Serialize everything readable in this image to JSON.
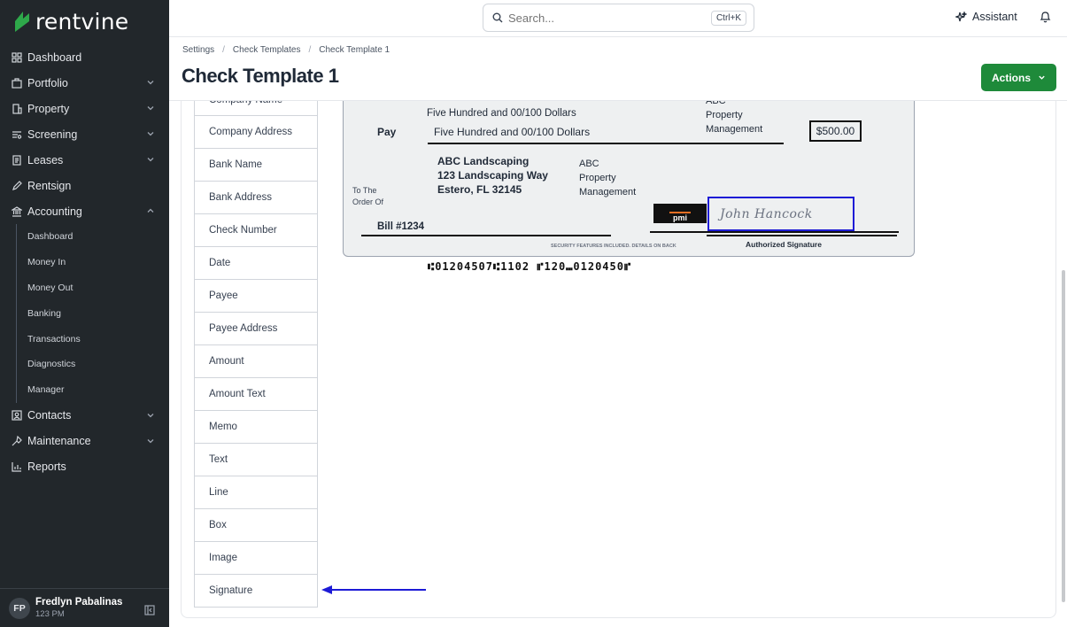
{
  "app": {
    "brand": "rentvine",
    "accent": "#1e8a3a"
  },
  "sidebar": {
    "items": [
      {
        "label": "Dashboard",
        "icon": "dashboard-icon",
        "chevron": false
      },
      {
        "label": "Portfolio",
        "icon": "briefcase-icon",
        "chevron": true
      },
      {
        "label": "Property",
        "icon": "building-icon",
        "chevron": true
      },
      {
        "label": "Screening",
        "icon": "screening-icon",
        "chevron": true
      },
      {
        "label": "Leases",
        "icon": "document-icon",
        "chevron": true
      },
      {
        "label": "Rentsign",
        "icon": "pen-icon",
        "chevron": false
      },
      {
        "label": "Accounting",
        "icon": "bank-icon",
        "chevron": true,
        "expanded": true
      }
    ],
    "accounting_sub": [
      "Dashboard",
      "Money In",
      "Money Out",
      "Banking",
      "Transactions",
      "Diagnostics",
      "Manager"
    ],
    "items_after": [
      {
        "label": "Contacts",
        "icon": "contacts-icon",
        "chevron": true
      },
      {
        "label": "Maintenance",
        "icon": "wrench-icon",
        "chevron": true
      },
      {
        "label": "Reports",
        "icon": "chart-icon",
        "chevron": false
      }
    ],
    "user": {
      "initials": "FP",
      "name": "Fredlyn Pabalinas",
      "sub": "123 PM"
    }
  },
  "topbar": {
    "search_placeholder": "Search...",
    "shortcut": "Ctrl+K",
    "assistant_label": "Assistant"
  },
  "breadcrumb": [
    "Settings",
    "Check Templates",
    "Check Template 1"
  ],
  "page_title": "Check Template 1",
  "actions_label": "Actions",
  "fields": [
    "Company Name",
    "Company Address",
    "Bank Name",
    "Bank Address",
    "Check Number",
    "Date",
    "Payee",
    "Payee Address",
    "Amount",
    "Amount Text",
    "Memo",
    "Text",
    "Line",
    "Box",
    "Image",
    "Signature"
  ],
  "check": {
    "amount_text_top": "Five Hundred and 00/100 Dollars",
    "pay_label": "Pay",
    "amount_text": "Five Hundred and 00/100 Dollars",
    "amount": "$500.00",
    "company_top": [
      "ABC",
      "Property",
      "Management"
    ],
    "payee_lines": [
      "ABC Landscaping",
      "123 Landscaping Way",
      "Estero, FL 32145"
    ],
    "company_mid": [
      "ABC",
      "Property",
      "Management"
    ],
    "to_order_1": "To The",
    "to_order_2": "Order Of",
    "memo": "Bill #1234",
    "logo_text": "pmi",
    "signature": "John Hancock",
    "signature_caption": "Authorized Signature",
    "security_text": "SECURITY FEATURES INCLUDED. DETAILS ON BACK",
    "micr": "⑆01204507⑆1102 ⑈120⑉0120450⑈"
  }
}
